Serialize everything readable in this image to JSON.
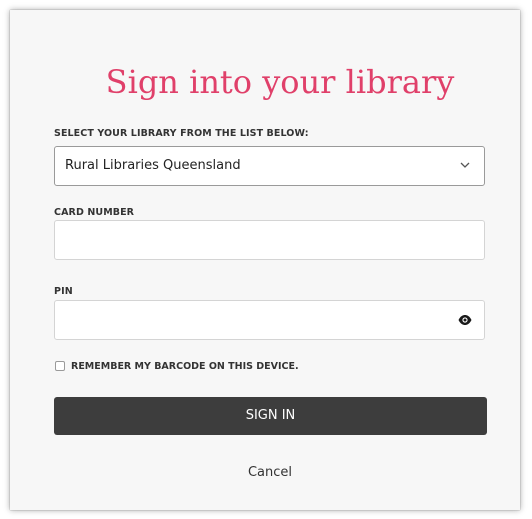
{
  "dialog": {
    "title": "Sign into your library",
    "library": {
      "label": "SELECT YOUR LIBRARY FROM THE LIST BELOW:",
      "selected": "Rural Libraries Queensland"
    },
    "card": {
      "label": "CARD NUMBER",
      "value": ""
    },
    "pin": {
      "label": "PIN",
      "value": ""
    },
    "remember": {
      "label": "REMEMBER MY BARCODE ON THIS DEVICE.",
      "checked": false
    },
    "signin_label": "SIGN IN",
    "cancel_label": "Cancel"
  },
  "colors": {
    "title": "#e0406a",
    "button": "#3d3d3d"
  },
  "icons": {
    "dropdown": "chevron-down-icon",
    "reveal": "eye-icon"
  }
}
